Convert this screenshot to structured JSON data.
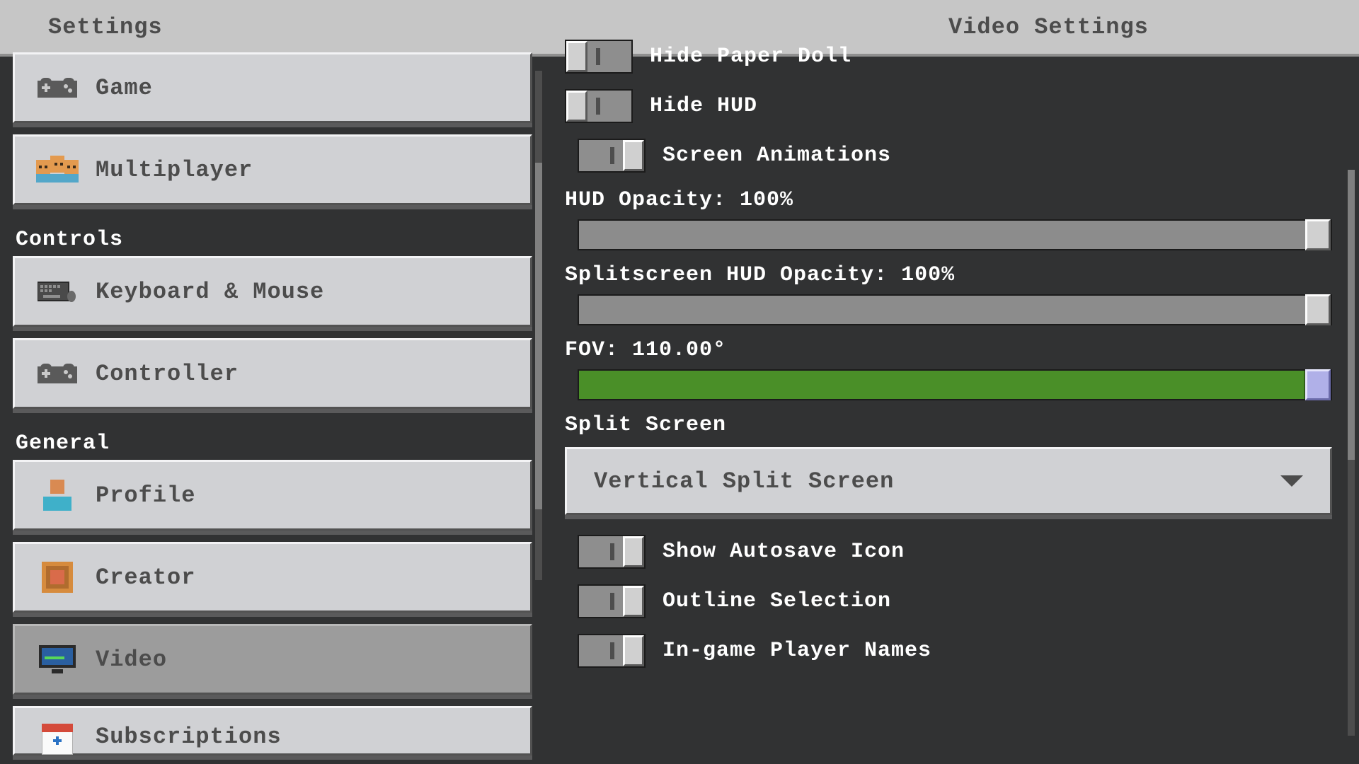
{
  "header": {
    "left_title": "Settings",
    "right_title": "Video Settings"
  },
  "sidebar": {
    "categories": [
      {
        "items": [
          {
            "label": "Game",
            "icon": "controller"
          },
          {
            "label": "Multiplayer",
            "icon": "multiplayer"
          }
        ]
      },
      {
        "header": "Controls",
        "items": [
          {
            "label": "Keyboard & Mouse",
            "icon": "keyboard"
          },
          {
            "label": "Controller",
            "icon": "controller"
          }
        ]
      },
      {
        "header": "General",
        "items": [
          {
            "label": "Profile",
            "icon": "profile"
          },
          {
            "label": "Creator",
            "icon": "creator"
          },
          {
            "label": "Video",
            "icon": "video",
            "selected": true
          },
          {
            "label": "Subscriptions",
            "icon": "subs"
          }
        ]
      }
    ]
  },
  "content": {
    "toggles_top": [
      {
        "label": "Hide Paper Doll",
        "on": false
      },
      {
        "label": "Hide HUD",
        "on": false
      },
      {
        "label": "Screen Animations",
        "on": true
      }
    ],
    "sliders": [
      {
        "label": "HUD Opacity: 100%",
        "percent": 100,
        "green": false
      },
      {
        "label": "Splitscreen HUD Opacity: 100%",
        "percent": 100,
        "green": false
      },
      {
        "label": "FOV: 110.00°",
        "percent": 100,
        "green": true,
        "highlight": true
      }
    ],
    "split_screen": {
      "label": "Split Screen",
      "value": "Vertical Split Screen"
    },
    "toggles_bottom": [
      {
        "label": "Show Autosave Icon",
        "on": true
      },
      {
        "label": "Outline Selection",
        "on": true
      },
      {
        "label": "In-game Player Names",
        "on": true
      }
    ]
  }
}
